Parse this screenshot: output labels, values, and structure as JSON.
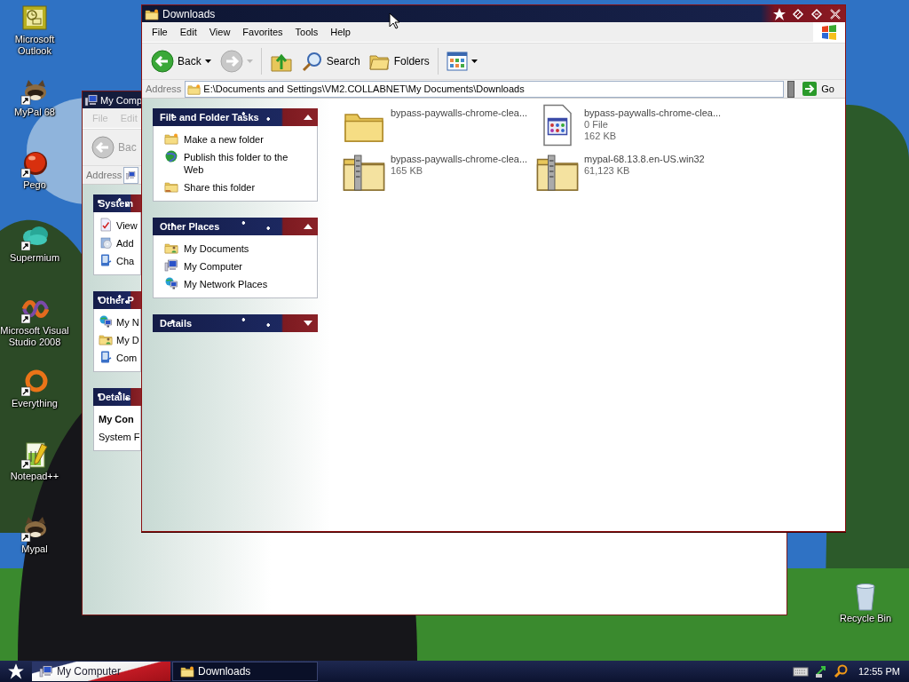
{
  "desktop": {
    "icons": [
      {
        "label": "Microsoft Outlook",
        "kind": "mail",
        "shortcut": false
      },
      {
        "label": "MyPal 68",
        "kind": "animal",
        "shortcut": true
      },
      {
        "label": "Pego",
        "kind": "ball",
        "shortcut": true
      },
      {
        "label": "Supermium",
        "kind": "cloud",
        "shortcut": true
      },
      {
        "label": "Microsoft Visual Studio 2008",
        "kind": "loop",
        "shortcut": true
      },
      {
        "label": "Everything",
        "kind": "ring",
        "shortcut": true
      },
      {
        "label": "Notepad++",
        "kind": "notepad",
        "shortcut": true
      },
      {
        "label": "Mypal",
        "kind": "animal",
        "shortcut": true
      }
    ],
    "recycle_bin": {
      "label": "Recycle Bin"
    }
  },
  "back_window": {
    "title": "My Comp",
    "menu": [
      "File",
      "Edit"
    ],
    "back_label": "Bac",
    "address_label": "Address",
    "panels": [
      {
        "title": "System",
        "items": [
          {
            "label": "View",
            "kind": "page"
          },
          {
            "label": "Add",
            "kind": "cd"
          },
          {
            "label": "Cha",
            "kind": "panel"
          }
        ]
      },
      {
        "title": "Other P",
        "items": [
          {
            "label": "My N",
            "kind": "network"
          },
          {
            "label": "My D",
            "kind": "documents"
          },
          {
            "label": "Com",
            "kind": "panel"
          }
        ]
      },
      {
        "title": "Details",
        "details": {
          "name": "My Con",
          "type": "System F"
        }
      }
    ]
  },
  "window": {
    "title": "Downloads",
    "menu": [
      "File",
      "Edit",
      "View",
      "Favorites",
      "Tools",
      "Help"
    ],
    "toolbar": [
      {
        "kind": "back",
        "label": "Back",
        "disabled": false
      },
      {
        "kind": "forward",
        "disabled": true
      },
      {
        "kind": "up",
        "disabled": false
      },
      {
        "kind": "search",
        "label": "Search",
        "disabled": false
      },
      {
        "kind": "folders",
        "label": "Folders",
        "disabled": false
      },
      {
        "kind": "views",
        "disabled": false
      }
    ],
    "address": {
      "label": "Address",
      "value": "E:\\Documents and Settings\\VM2.COLLABNET\\My Documents\\Downloads",
      "go": "Go"
    },
    "sidebar": [
      {
        "title": "File and Folder Tasks",
        "expanded": true,
        "items": [
          {
            "label": "Make a new folder",
            "kind": "new-folder"
          },
          {
            "label": "Publish this folder to the Web",
            "kind": "globe"
          },
          {
            "label": "Share this folder",
            "kind": "share"
          }
        ]
      },
      {
        "title": "Other Places",
        "expanded": true,
        "items": [
          {
            "label": "My Documents",
            "kind": "documents"
          },
          {
            "label": "My Computer",
            "kind": "computer"
          },
          {
            "label": "My Network Places",
            "kind": "network"
          }
        ]
      },
      {
        "title": "Details",
        "expanded": false
      }
    ],
    "files": [
      {
        "name": "bypass-paywalls-chrome-clea...",
        "kind": "folder"
      },
      {
        "name": "bypass-paywalls-chrome-clea...",
        "kind": "file",
        "details": [
          "0 File",
          "162 KB"
        ]
      },
      {
        "name": "bypass-paywalls-chrome-clea...",
        "kind": "zip",
        "details": [
          "165 KB"
        ]
      },
      {
        "name": "mypal-68.13.8.en-US.win32",
        "kind": "zip",
        "details": [
          "61,123 KB"
        ]
      }
    ]
  },
  "taskbar": {
    "tasks": [
      {
        "label": "My Computer",
        "selected": false
      },
      {
        "label": "Downloads",
        "selected": true
      }
    ],
    "clock": "12:55 PM"
  }
}
